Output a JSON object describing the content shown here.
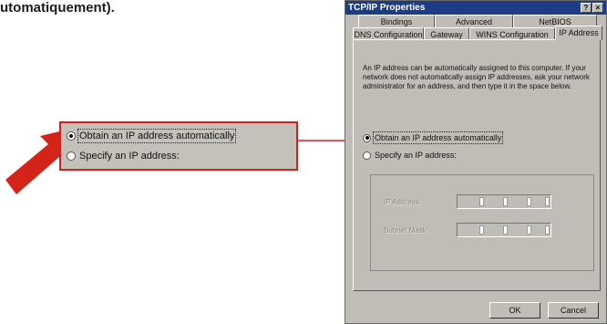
{
  "caption": "utomatiquement).",
  "callout": {
    "option_auto": "Obtain an IP address automatically",
    "option_specify": "Specify an IP address:"
  },
  "dialog": {
    "title": "TCP/IP Properties",
    "help_button": "?",
    "close_button": "×",
    "tabs_back": [
      "Bindings",
      "Advanced",
      "NetBIOS"
    ],
    "tabs_front": [
      "DNS Configuration",
      "Gateway",
      "WINS Configuration",
      "IP Address"
    ],
    "description": "An IP address can be automatically assigned to this computer. If your network does not automatically assign IP addresses, ask your network administrator for an address, and then type it in the space below.",
    "option_auto": "Obtain an IP address automatically",
    "option_specify": "Specify an IP address:",
    "ip_address_label": "IP Address:",
    "subnet_mask_label": "Subnet Mask:",
    "ok_label": "OK",
    "cancel_label": "Cancel"
  },
  "colors": {
    "accent_red": "#d22020",
    "titlebar": "#1c3d84",
    "dialog_bg": "#c0bdb6"
  }
}
